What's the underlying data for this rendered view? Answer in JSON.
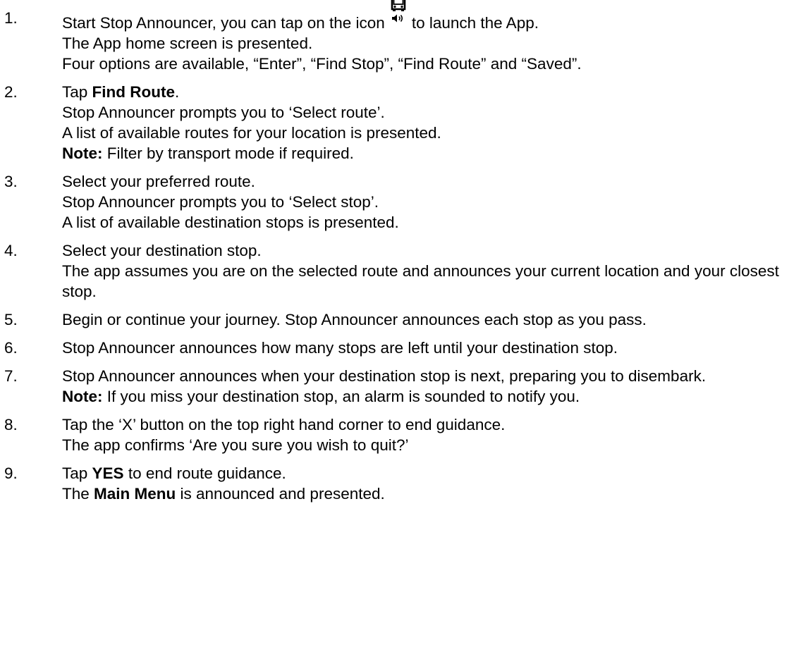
{
  "steps": [
    {
      "number": "1.",
      "lines": [
        {
          "before_icon": "Start Stop Announcer, you can tap on the icon",
          "after_icon": "to launch the App.",
          "icon": "bus-speaker-icon"
        },
        {
          "text": "The App home screen is presented."
        },
        {
          "text": "Four options are available, “Enter”, “Find Stop”, “Find Route” and “Saved”."
        }
      ]
    },
    {
      "number": "2.",
      "lines": [
        {
          "prefix": "Tap ",
          "bold": "Find Route",
          "suffix": "."
        },
        {
          "text": "Stop Announcer prompts you to ‘Select route’."
        },
        {
          "text": "A list of available routes for your location is presented."
        },
        {
          "bold": "Note:",
          "suffix": " Filter by transport mode if required."
        }
      ]
    },
    {
      "number": "3.",
      "lines": [
        {
          "text": "Select your preferred route."
        },
        {
          "text": "Stop Announcer prompts you to ‘Select stop’."
        },
        {
          "text": "A list of available destination stops is presented."
        }
      ]
    },
    {
      "number": "4.",
      "lines": [
        {
          "text": "Select your destination stop."
        },
        {
          "text": "The app assumes you are on the selected route and announces your current location and your closest stop."
        }
      ]
    },
    {
      "number": "5.",
      "lines": [
        {
          "text": "Begin or continue your journey. Stop Announcer announces each stop as you pass."
        }
      ]
    },
    {
      "number": "6.",
      "lines": [
        {
          "text": "Stop Announcer announces how many stops are left until your destination stop."
        }
      ]
    },
    {
      "number": "7.",
      "lines": [
        {
          "text": "Stop Announcer announces when your destination stop is next, preparing you to disembark."
        },
        {
          "bold": "Note:",
          "suffix": " If you miss your destination stop, an alarm is sounded to notify you."
        }
      ]
    },
    {
      "number": "8.",
      "lines": [
        {
          "text": "Tap the ‘X’ button on the top right hand corner to end guidance."
        },
        {
          "text": "The app confirms ‘Are you sure you wish to quit?’"
        }
      ]
    },
    {
      "number": "9.",
      "lines": [
        {
          "prefix": "Tap ",
          "bold": "YES",
          "suffix": " to end route guidance."
        },
        {
          "prefix": "The ",
          "bold": "Main Menu",
          "suffix": " is announced and presented."
        }
      ]
    }
  ]
}
